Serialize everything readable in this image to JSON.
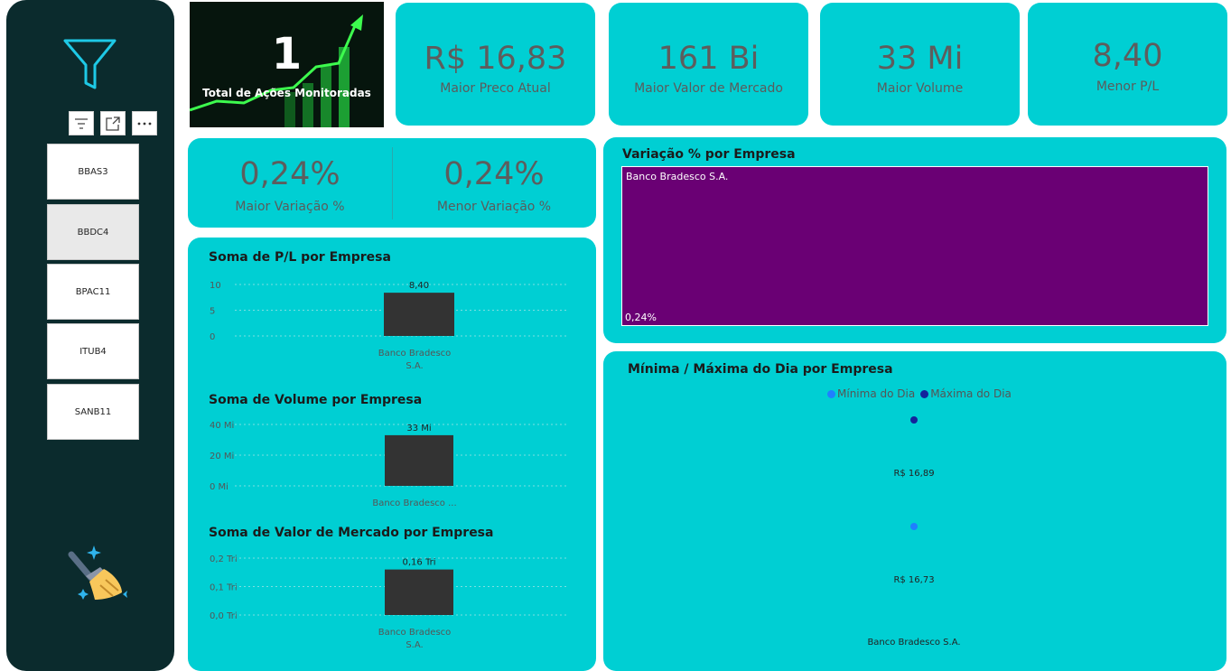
{
  "slicer": {
    "items": [
      "BBAS3",
      "BBDC4",
      "BPAC11",
      "ITUB4",
      "SANB11"
    ],
    "selected_index": 1
  },
  "hero": {
    "value": "1",
    "label": "Total de Ações Monitoradas"
  },
  "kpis": [
    {
      "value": "R$ 16,83",
      "label": "Maior Preco Atual"
    },
    {
      "value": "161 Bi",
      "label": "Maior Valor de Mercado"
    },
    {
      "value": "33 Mi",
      "label": "Maior Volume"
    },
    {
      "value": "8,40",
      "label": "Menor P/L"
    }
  ],
  "variation": {
    "max": {
      "value": "0,24%",
      "label": "Maior Variação %"
    },
    "min": {
      "value": "0,24%",
      "label": "Menor Variação %"
    }
  },
  "colors": {
    "card": "#00cfd3",
    "sidebar": "#0b2b2d",
    "bar": "#333333",
    "treemap": "#6a0074",
    "min_dot": "#1f7fff",
    "max_dot": "#14239b"
  },
  "chart_data": [
    {
      "type": "bar",
      "title": "Soma de P/L por Empresa",
      "categories": [
        "Banco Bradesco S.A."
      ],
      "category_tick_lines": [
        "Banco Bradesco",
        "S.A."
      ],
      "values": [
        8.4
      ],
      "data_labels": [
        "8,40"
      ],
      "yticks": [
        "10",
        "5",
        "0"
      ],
      "ylim": [
        0,
        10
      ]
    },
    {
      "type": "bar",
      "title": "Soma de Volume por Empresa",
      "categories": [
        "Banco Bradesco ..."
      ],
      "category_tick_lines": [
        "Banco Bradesco ..."
      ],
      "values": [
        33
      ],
      "data_labels": [
        "33 Mi"
      ],
      "yticks": [
        "40 Mi",
        "20 Mi",
        "0 Mi"
      ],
      "ylim": [
        0,
        40
      ]
    },
    {
      "type": "bar",
      "title": "Soma de Valor de Mercado por Empresa",
      "categories": [
        "Banco Bradesco S.A."
      ],
      "category_tick_lines": [
        "Banco Bradesco",
        "S.A."
      ],
      "values": [
        0.16
      ],
      "data_labels": [
        "0,16 Tri"
      ],
      "yticks": [
        "0,2 Tri",
        "0,1 Tri",
        "0,0 Tri"
      ],
      "ylim": [
        0,
        0.2
      ]
    },
    {
      "type": "treemap",
      "title": "Variação % por Empresa",
      "categories": [
        "Banco Bradesco S.A."
      ],
      "values": [
        0.24
      ],
      "data_labels": [
        "0,24%"
      ]
    },
    {
      "type": "scatter",
      "title": "Mínima / Máxima do Dia por Empresa",
      "categories": [
        "Banco Bradesco S.A."
      ],
      "legend": [
        "Mínima do Dia",
        "Máxima do Dia"
      ],
      "series": [
        {
          "name": "Mínima do Dia",
          "values": [
            16.73
          ],
          "label": "R$ 16,73"
        },
        {
          "name": "Máxima do Dia",
          "values": [
            16.89
          ],
          "label": "R$ 16,89"
        }
      ]
    }
  ]
}
